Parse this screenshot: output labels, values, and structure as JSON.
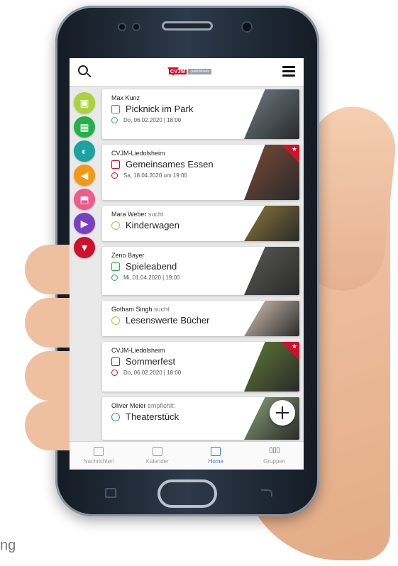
{
  "header": {
    "logo_text": "CVJM",
    "logo_sub": "Liedolsheim"
  },
  "icons": {
    "search": "search-icon",
    "menu": "hamburger-menu-icon"
  },
  "categories": [
    {
      "name": "gift",
      "color": "#a9d33b",
      "glyph": "▣"
    },
    {
      "name": "calendar",
      "color": "#27b04a",
      "glyph": "▦"
    },
    {
      "name": "lightbulb",
      "color": "#1aa3a0",
      "glyph": "◐"
    },
    {
      "name": "megaphone",
      "color": "#f39a14",
      "glyph": "◀"
    },
    {
      "name": "shirt",
      "color": "#f05a8e",
      "glyph": "⬒"
    },
    {
      "name": "play",
      "color": "#7b3fc4",
      "glyph": "▶"
    },
    {
      "name": "cvjm",
      "color": "#d0112b",
      "glyph": "▼"
    }
  ],
  "cards": [
    {
      "author": "Max Kunz",
      "verb": "",
      "title": "Picknick im Park",
      "date": "Do, 06.02.2020 | 18:00",
      "accent": "#27b04a",
      "type": "event",
      "favorite": false,
      "photo": "#6f7d86"
    },
    {
      "author": "CVJM-Liedolsheim",
      "verb": "",
      "title": "Gemeinsames Essen",
      "date": "Sa, 18.04.2020 um 19:00",
      "accent": "#d0112b",
      "type": "event",
      "favorite": true,
      "photo": "#7a4a36"
    },
    {
      "author": "Mara Weber",
      "verb": "sucht",
      "title": "Kinderwagen",
      "date": "",
      "accent": "#a9c93b",
      "type": "search",
      "favorite": false,
      "photo": "#8d7a3a"
    },
    {
      "author": "Zeno Bayer",
      "verb": "",
      "title": "Spieleabend",
      "date": "Mi, 01.04.2020 | 19:00",
      "accent": "#27b04a",
      "type": "event",
      "favorite": false,
      "photo": "#5a5a56"
    },
    {
      "author": "Gotham Singh",
      "verb": "sucht",
      "title": "Lesenswerte Bücher",
      "date": "",
      "accent": "#a9c93b",
      "type": "search",
      "favorite": false,
      "photo": "#d8c9bc"
    },
    {
      "author": "CVJM-Liedolsheim",
      "verb": "",
      "title": "Sommerfest",
      "date": "Do, 06.02.2020 | 18:00",
      "accent": "#d0112b",
      "type": "event",
      "favorite": true,
      "photo": "#5f7a34"
    },
    {
      "author": "Oliver Meier",
      "verb": "empfiehlt:",
      "title": "Theaterstück",
      "date": "",
      "accent": "#1aa3a0",
      "type": "tip",
      "favorite": false,
      "photo": "#8aa377"
    }
  ],
  "tabs": [
    {
      "label": "Nachrichten",
      "active": false
    },
    {
      "label": "Kalender",
      "active": false
    },
    {
      "label": "Home",
      "active": true
    },
    {
      "label": "Gruppen",
      "active": false
    }
  ],
  "caption": "ng"
}
